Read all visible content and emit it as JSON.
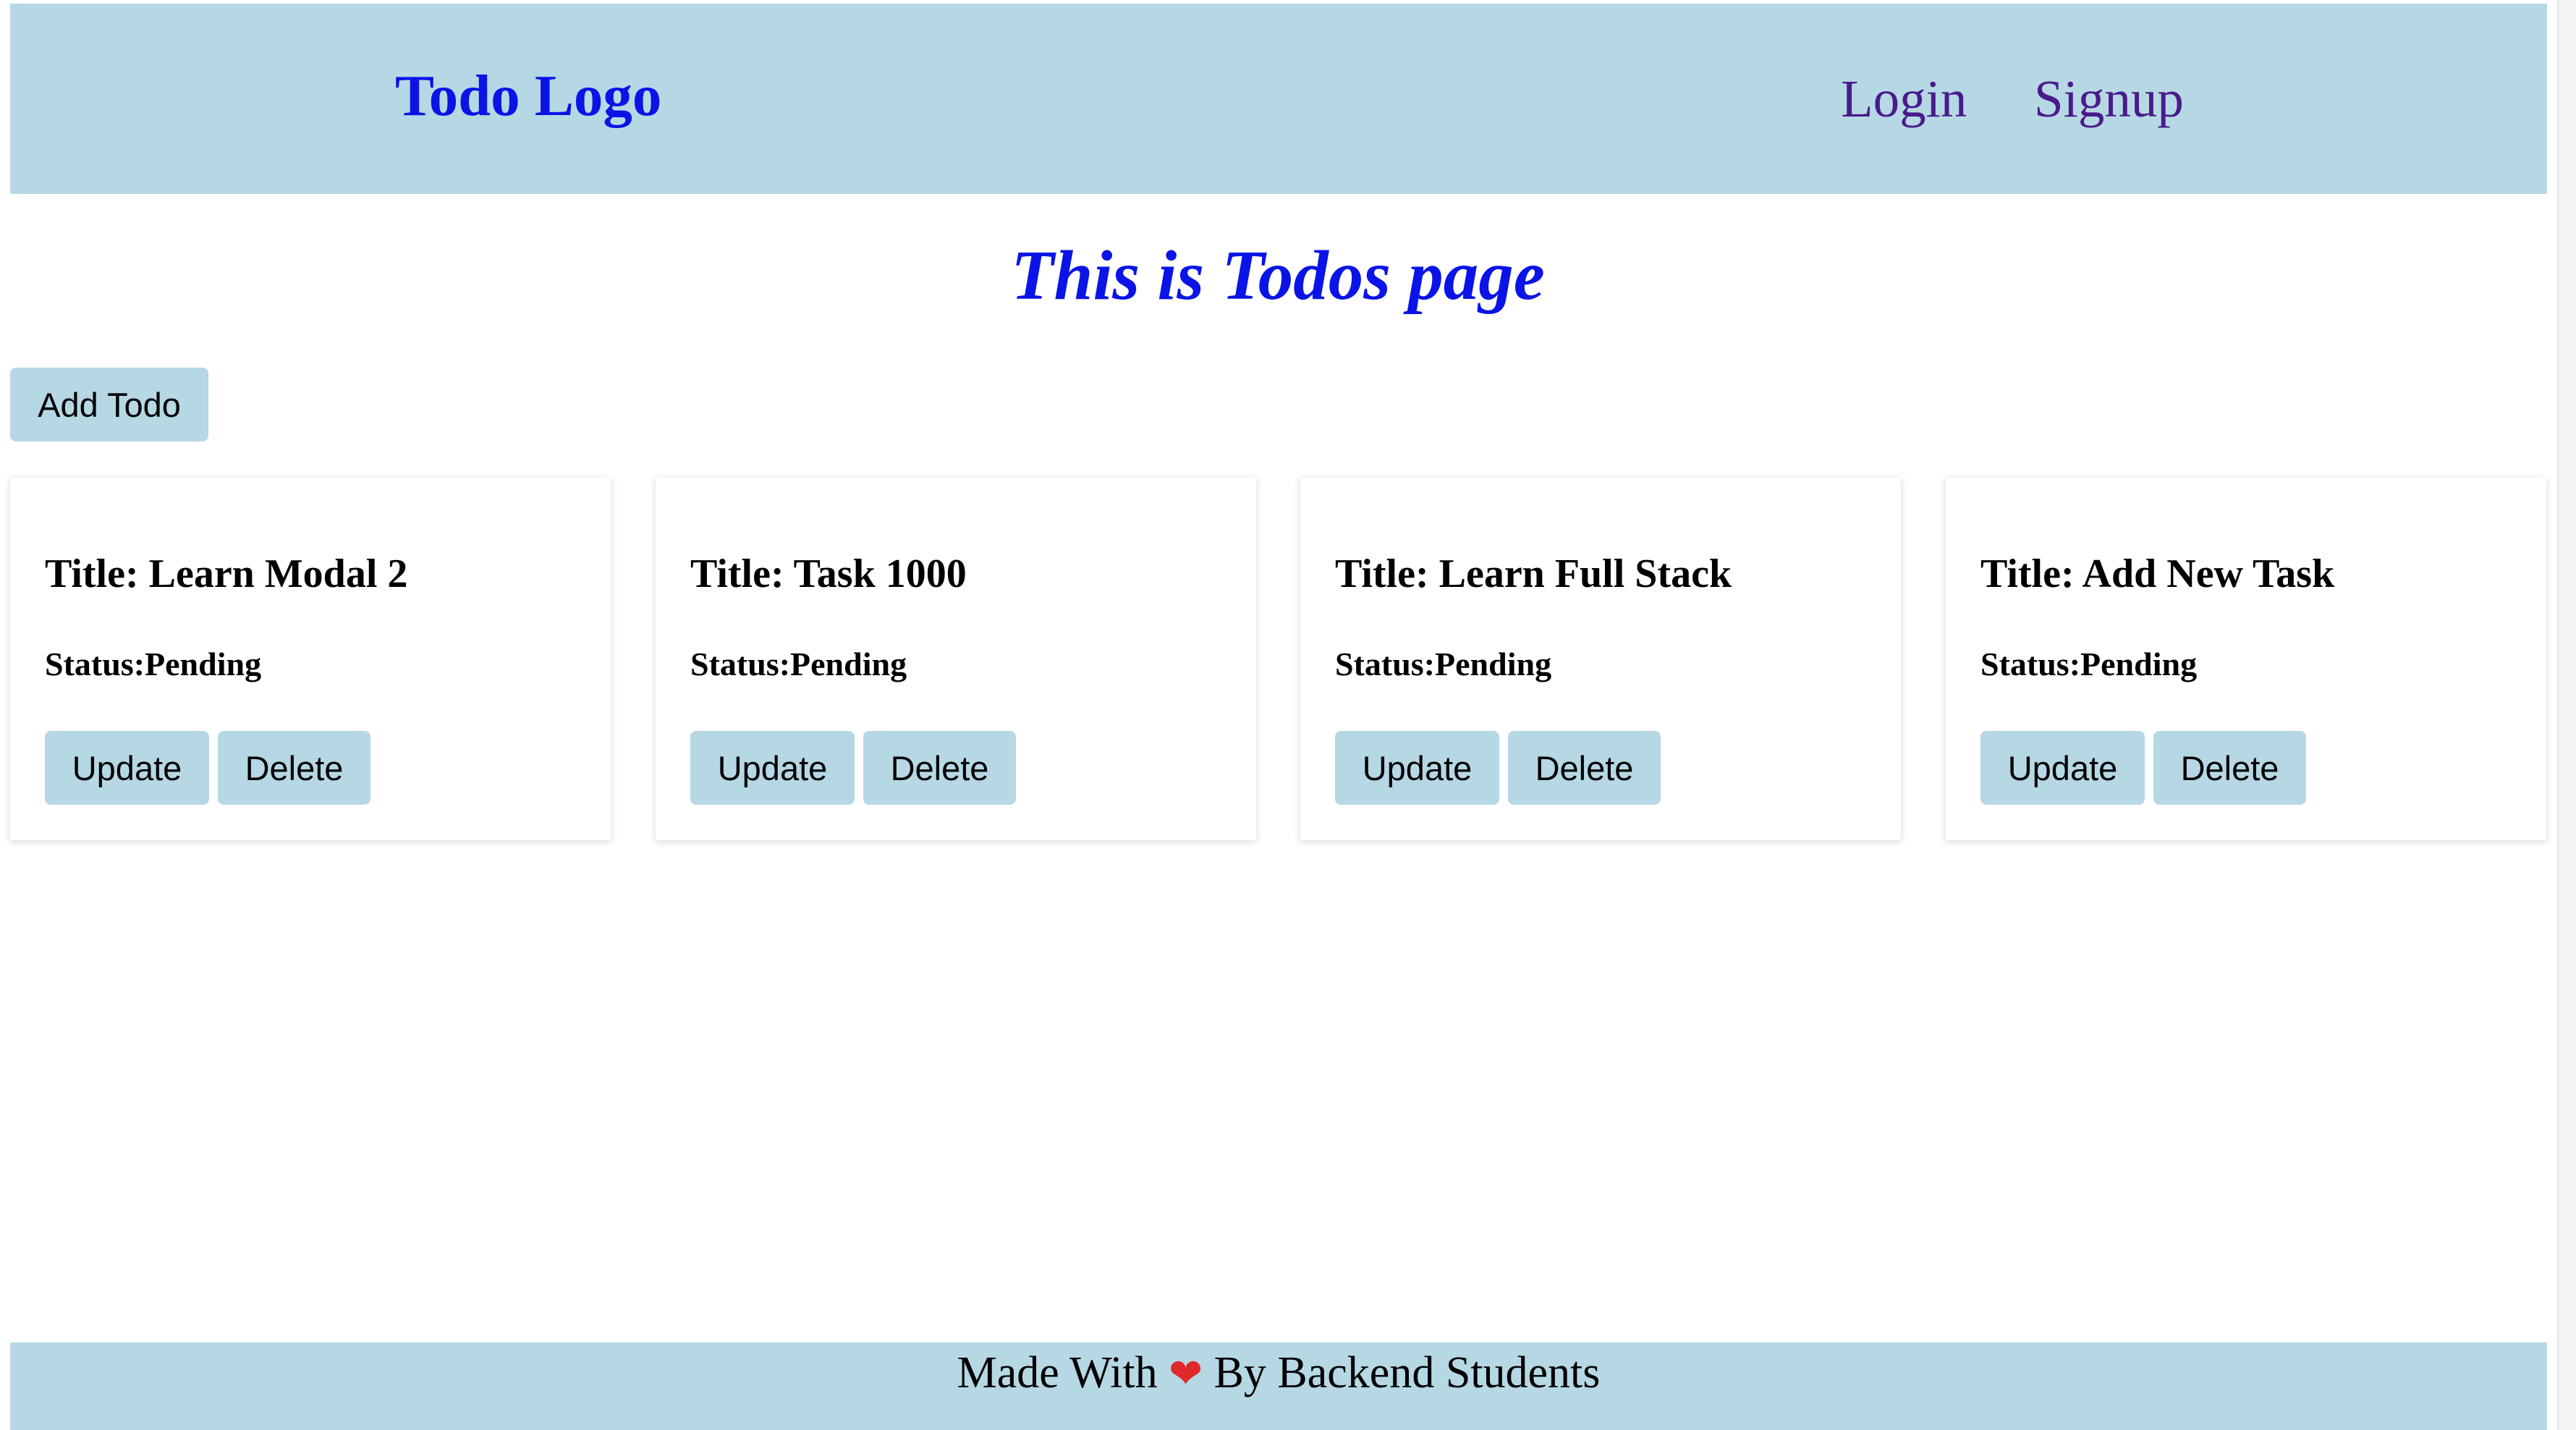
{
  "navbar": {
    "logo": "Todo Logo",
    "links": [
      "Login",
      "Signup"
    ]
  },
  "page": {
    "title": "This is Todos page",
    "add_button": "Add Todo"
  },
  "todos": [
    {
      "title": "Title: Learn Modal 2",
      "status": "Status:Pending",
      "update_label": "Update",
      "delete_label": "Delete"
    },
    {
      "title": "Title: Task 1000",
      "status": "Status:Pending",
      "update_label": "Update",
      "delete_label": "Delete"
    },
    {
      "title": "Title: Learn Full Stack",
      "status": "Status:Pending",
      "update_label": "Update",
      "delete_label": "Delete"
    },
    {
      "title": "Title: Add New Task",
      "status": "Status:Pending",
      "update_label": "Update",
      "delete_label": "Delete"
    }
  ],
  "footer": {
    "prefix": "Made With",
    "heart": "❤",
    "suffix": "By Backend Students"
  },
  "colors": {
    "nav_bg": "#b6d8e4",
    "logo": "#0a14e6",
    "nav_link": "#4a1a8c",
    "heart": "#e0292b"
  },
  "icons": [
    "heart-icon"
  ]
}
